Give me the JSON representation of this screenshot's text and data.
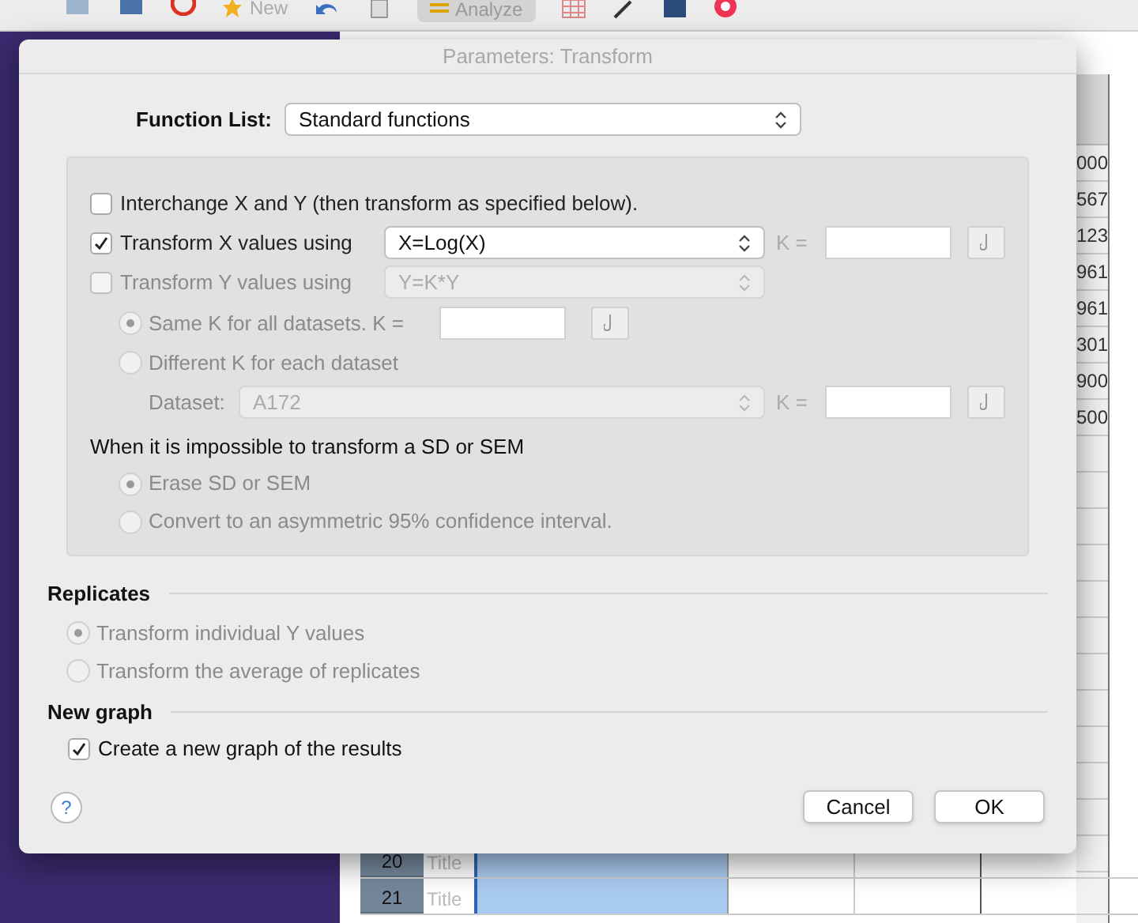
{
  "toolbar": {
    "new_label": "New",
    "analyze_label": "Analyze"
  },
  "sheet": {
    "column_values": [
      "000",
      "567",
      "123",
      "961",
      "961",
      "301",
      "900",
      "500"
    ],
    "rows": [
      {
        "number": "20",
        "title": "Title"
      },
      {
        "number": "21",
        "title": "Title"
      }
    ]
  },
  "dialog": {
    "title": "Parameters: Transform",
    "function_list": {
      "label": "Function List:",
      "value": "Standard functions"
    },
    "options": [
      {
        "kind": "checkbox",
        "label": "Interchange X and Y (then transform as specified below).",
        "checked": false,
        "disabled": false
      },
      {
        "kind": "checkbox_select",
        "label": "Transform X values using",
        "checked": true,
        "disabled": false,
        "select": "X=Log(X)",
        "k_label": "K ="
      },
      {
        "kind": "checkbox_select",
        "label": "Transform Y values using",
        "checked": false,
        "disabled": true,
        "select": "Y=K*Y"
      },
      {
        "kind": "radio_k",
        "label": "Same K for all datasets. K =",
        "selected": true,
        "disabled": true
      },
      {
        "kind": "radio",
        "label": "Different K for each dataset",
        "selected": false,
        "disabled": true
      },
      {
        "kind": "dataset",
        "label": "Dataset:",
        "select": "A172",
        "disabled": true,
        "k_label": "K ="
      }
    ],
    "sd_heading": "When it is impossible to transform a SD or SEM",
    "sd_options": [
      {
        "label": "Erase SD or SEM",
        "selected": true,
        "disabled": true
      },
      {
        "label": "Convert to an asymmetric 95% confidence interval.",
        "selected": false,
        "disabled": true
      }
    ],
    "replicates": {
      "heading": "Replicates",
      "options": [
        {
          "label": "Transform individual Y values",
          "selected": true,
          "disabled": true
        },
        {
          "label": "Transform the average of replicates",
          "selected": false,
          "disabled": true
        }
      ]
    },
    "new_graph": {
      "heading": "New graph",
      "label": "Create a new graph of the results",
      "checked": true
    },
    "help": "?",
    "buttons": [
      "Cancel",
      "OK"
    ]
  }
}
